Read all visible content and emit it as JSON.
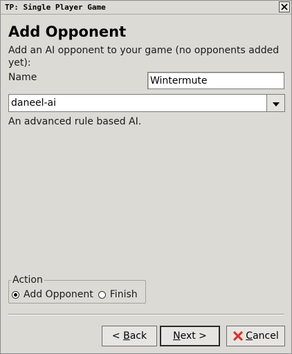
{
  "window": {
    "title": "TP: Single Player Game"
  },
  "page": {
    "heading": "Add Opponent",
    "description": "Add an AI opponent to your game (no opponents added yet):",
    "name_label": "Name",
    "name_value": "Wintermute",
    "ai_selected": "daneel-ai",
    "ai_description": "An advanced rule based AI."
  },
  "action": {
    "legend": "Action",
    "options": [
      {
        "label": "Add Opponent",
        "checked": true
      },
      {
        "label": "Finish",
        "checked": false
      }
    ]
  },
  "buttons": {
    "back_prefix": "< ",
    "back_mnemonic": "B",
    "back_rest": "ack",
    "next_mnemonic": "N",
    "next_rest": "ext >",
    "cancel_mnemonic": "C",
    "cancel_rest": "ancel"
  },
  "icons": {
    "close": "close-icon",
    "dropdown": "chevron-down-icon",
    "cancel": "cancel-x-icon"
  },
  "colors": {
    "window_bg": "#dcdad5",
    "cancel_icon": "#d9342b"
  }
}
